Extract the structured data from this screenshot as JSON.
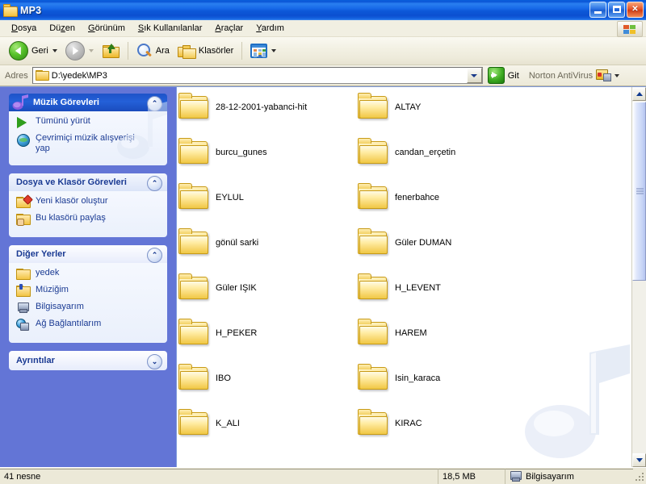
{
  "window": {
    "title": "MP3",
    "title_icon": "folder-icon",
    "controls": {
      "minimize": "minimize-button",
      "maximize": "maximize-button",
      "close": "close-button"
    }
  },
  "menu": {
    "items": [
      {
        "label": "Dosya",
        "accel": "D"
      },
      {
        "label": "Düzen",
        "accel": "z"
      },
      {
        "label": "Görünüm",
        "accel": "G"
      },
      {
        "label": "Sık Kullanılanlar",
        "accel": "S"
      },
      {
        "label": "Araçlar",
        "accel": "A"
      },
      {
        "label": "Yardım",
        "accel": "Y"
      }
    ]
  },
  "toolbar": {
    "back_label": "Geri",
    "forward_label": "",
    "up_label": "",
    "search_label": "Ara",
    "folders_label": "Klasörler",
    "views_label": ""
  },
  "address": {
    "label": "Adres",
    "path": "D:\\yedek\\MP3",
    "go_label": "Git",
    "norton_label": "Norton AntiVirus"
  },
  "sidebar": {
    "panels": [
      {
        "title": "Müzik Görevleri",
        "style": "blue",
        "collapsed": false,
        "chevron": "collapse-chevron-up",
        "items": [
          {
            "label": "Tümünü yürüt",
            "icon": "play-icon"
          },
          {
            "label": "Çevrimiçi müzik alışverişi yap",
            "icon": "globe-icon"
          }
        ]
      },
      {
        "title": "Dosya ve Klasör Görevleri",
        "style": "light",
        "collapsed": false,
        "chevron": "collapse-chevron-up",
        "items": [
          {
            "label": "Yeni klasör oluştur",
            "icon": "new-folder-icon"
          },
          {
            "label": "Bu klasörü paylaş",
            "icon": "share-folder-icon"
          }
        ]
      },
      {
        "title": "Diğer Yerler",
        "style": "light",
        "collapsed": false,
        "chevron": "collapse-chevron-up",
        "items": [
          {
            "label": "yedek",
            "icon": "folder-icon"
          },
          {
            "label": "Müziğim",
            "icon": "music-folder-icon"
          },
          {
            "label": "Bilgisayarım",
            "icon": "computer-icon"
          },
          {
            "label": "Ağ Bağlantılarım",
            "icon": "network-icon"
          }
        ]
      },
      {
        "title": "Ayrıntılar",
        "style": "light",
        "collapsed": true,
        "chevron": "expand-chevron-down",
        "items": []
      }
    ]
  },
  "files": {
    "view": "icons",
    "items": [
      {
        "name": "28-12-2001-yabanci-hit",
        "type": "folder"
      },
      {
        "name": "ALTAY",
        "type": "folder"
      },
      {
        "name": "burcu_gunes",
        "type": "folder"
      },
      {
        "name": "candan_erçetin",
        "type": "folder"
      },
      {
        "name": "EYLUL",
        "type": "folder"
      },
      {
        "name": "fenerbahce",
        "type": "folder"
      },
      {
        "name": "gönül sarki",
        "type": "folder"
      },
      {
        "name": "Güler DUMAN",
        "type": "folder"
      },
      {
        "name": "Güler IŞIK",
        "type": "folder"
      },
      {
        "name": "H_LEVENT",
        "type": "folder"
      },
      {
        "name": "H_PEKER",
        "type": "folder"
      },
      {
        "name": "HAREM",
        "type": "folder"
      },
      {
        "name": "IBO",
        "type": "folder"
      },
      {
        "name": "Isin_karaca",
        "type": "folder"
      },
      {
        "name": "K_ALI",
        "type": "folder"
      },
      {
        "name": "KIRAC",
        "type": "folder"
      }
    ]
  },
  "statusbar": {
    "object_count": "41 nesne",
    "size": "18,5 MB",
    "location": "Bilgisayarım"
  },
  "colors": {
    "titlebar_blue": "#0a54d6",
    "sidebar_blue": "#6375d6",
    "toolbar_cream": "#ece9d8",
    "link_blue": "#1a3a93",
    "folder_yellow": "#f5c93f"
  }
}
